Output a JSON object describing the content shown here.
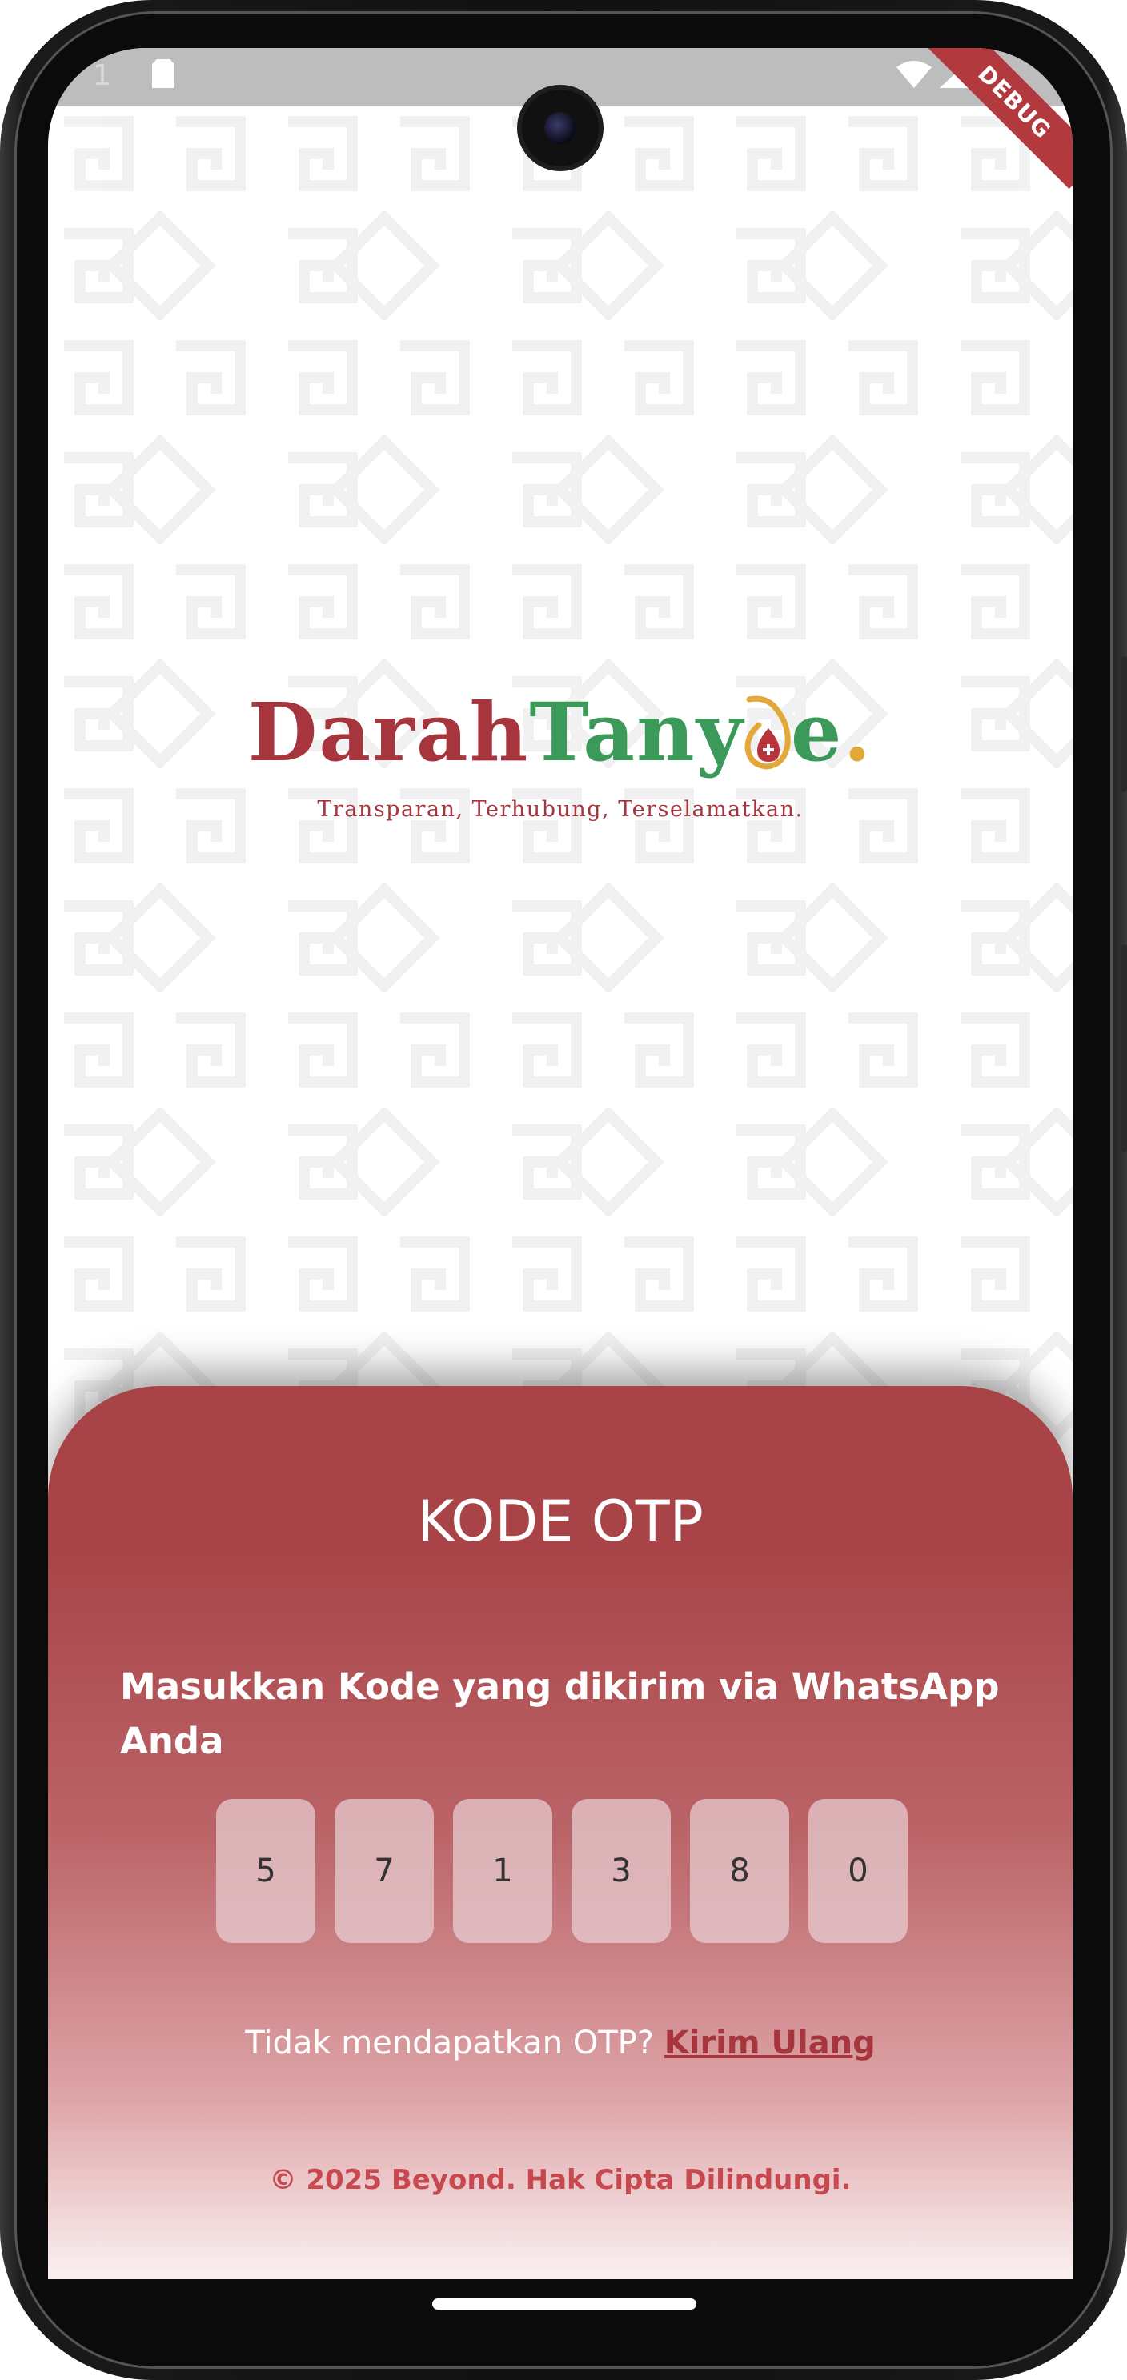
{
  "status_bar": {
    "signal_text": "1",
    "debug_label": "DEBUG"
  },
  "logo": {
    "part1": "Darah",
    "part2": "Tany",
    "part3": "e",
    "part4": ".",
    "tagline": "Transparan, Terhubung, Terselamatkan."
  },
  "otp": {
    "title": "KODE OTP",
    "instruction": "Masukkan Kode yang dikirim via WhatsApp Anda",
    "digits": [
      "5",
      "7",
      "1",
      "3",
      "8",
      "0"
    ],
    "resend_prompt": "Tidak mendapatkan OTP?",
    "resend_link": "Kirim Ulang"
  },
  "footer": {
    "copyright": "© 2025 Beyond. Hak Cipta Dilindungi."
  },
  "colors": {
    "brand_red": "#a7353e",
    "brand_green": "#3b9a5a",
    "panel_red": "#a84448",
    "accent_gold": "#e3a83a"
  },
  "icons": [
    "sim-card-icon",
    "wifi-icon",
    "signal-icon",
    "battery-icon",
    "blood-drop-logo-icon"
  ]
}
